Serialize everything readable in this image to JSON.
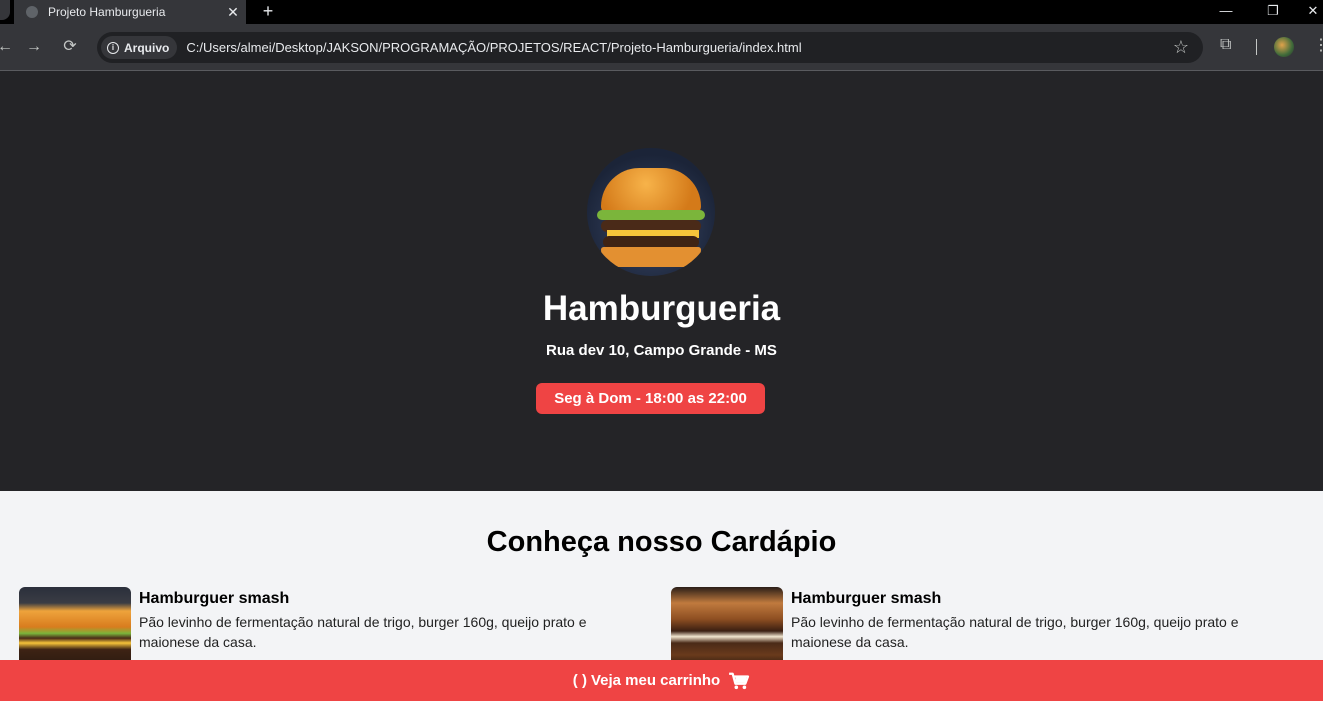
{
  "browser": {
    "tab_title": "Projeto Hamburgueria",
    "tab_close": "✕",
    "new_tab": "+",
    "back": "←",
    "forward": "→",
    "reload": "⟳",
    "chip_label": "Arquivo",
    "info_glyph": "i",
    "url": "C:/Users/almei/Desktop/JAKSON/PROGRAMAÇÃO/PROJETOS/REACT/Projeto-Hamburgueria/index.html",
    "bookmark": "☆",
    "extensions": "⧉",
    "more": "⋮",
    "minimize": "—",
    "maximize": "❐",
    "close": "✕"
  },
  "hero": {
    "title": "Hamburgueria",
    "address": "Rua dev 10, Campo Grande - MS",
    "hours": "Seg à Dom - 18:00 as 22:00"
  },
  "menu": {
    "title": "Conheça nosso Cardápio",
    "items": [
      {
        "name": "Hamburguer smash",
        "description": "Pão levinho de fermentação natural de trigo, burger 160g, queijo prato e maionese da casa."
      },
      {
        "name": "Hamburguer smash",
        "description": "Pão levinho de fermentação natural de trigo, burger 160g, queijo prato e maionese da casa."
      }
    ]
  },
  "cart": {
    "count_text": "(   )",
    "label": "Veja meu carrinho",
    "icon": "cart-icon"
  },
  "colors": {
    "hero_bg": "#242427",
    "accent": "#ef4444",
    "page_bg": "#f3f4f6"
  }
}
